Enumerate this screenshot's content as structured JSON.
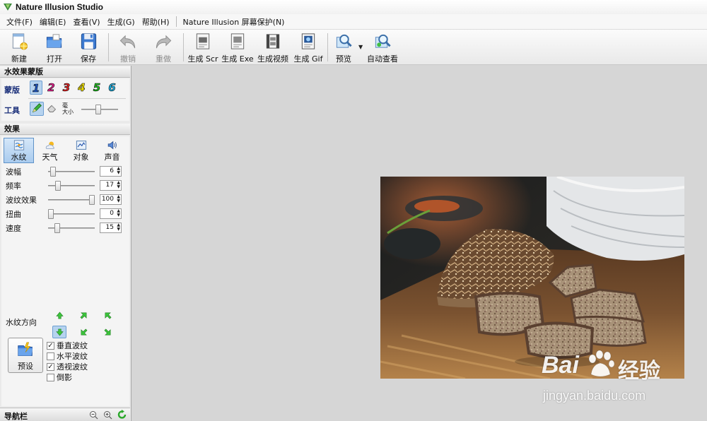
{
  "window": {
    "title": "Nature Illusion Studio"
  },
  "menu": {
    "items": [
      "文件(F)",
      "编辑(E)",
      "查看(V)",
      "生成(G)",
      "帮助(H)"
    ],
    "extra": "Nature Illusion 屏幕保护(N)"
  },
  "toolbar": {
    "new": "新建",
    "open": "打开",
    "save": "保存",
    "undo": "撤销",
    "redo": "重做",
    "gen_scr": "生成 Scr",
    "gen_exe": "生成 Exe",
    "gen_video": "生成视频",
    "gen_gif": "生成 Gif",
    "preview": "预览",
    "auto_view": "自动查看"
  },
  "mask_section": {
    "title": "水效果蒙版",
    "mask_label": "蒙版",
    "masks": [
      "1",
      "2",
      "3",
      "4",
      "5",
      "6"
    ],
    "mask_colors": [
      "#1e58c8",
      "#e0208a",
      "#e02020",
      "#f0e000",
      "#20c020",
      "#20b0e0"
    ],
    "active_mask": "1",
    "tool_label": "工具",
    "size_label": "大小",
    "size_small_label": "毫"
  },
  "effects_section": {
    "title": "效果",
    "tabs": [
      "水纹",
      "天气",
      "对象",
      "声音"
    ],
    "active_tab": "水纹",
    "params": [
      {
        "label": "波幅",
        "value": "6",
        "level": 0.06
      },
      {
        "label": "频率",
        "value": "17",
        "level": 0.17
      },
      {
        "label": "波纹效果",
        "value": "100",
        "level": 1.0
      },
      {
        "label": "扭曲",
        "value": "0",
        "level": 0.0
      },
      {
        "label": "速度",
        "value": "15",
        "level": 0.15
      }
    ],
    "direction_label": "水纹方向",
    "preset_label": "预设",
    "checks": [
      {
        "label": "垂直波纹",
        "checked": true
      },
      {
        "label": "水平波纹",
        "checked": false
      },
      {
        "label": "透视波纹",
        "checked": true
      },
      {
        "label": "倒影",
        "checked": false
      }
    ]
  },
  "navbar": {
    "title": "导航栏"
  },
  "watermark": {
    "brand_a": "Bai",
    "brand_b": "经验",
    "url": "jingyan.baidu.com"
  }
}
